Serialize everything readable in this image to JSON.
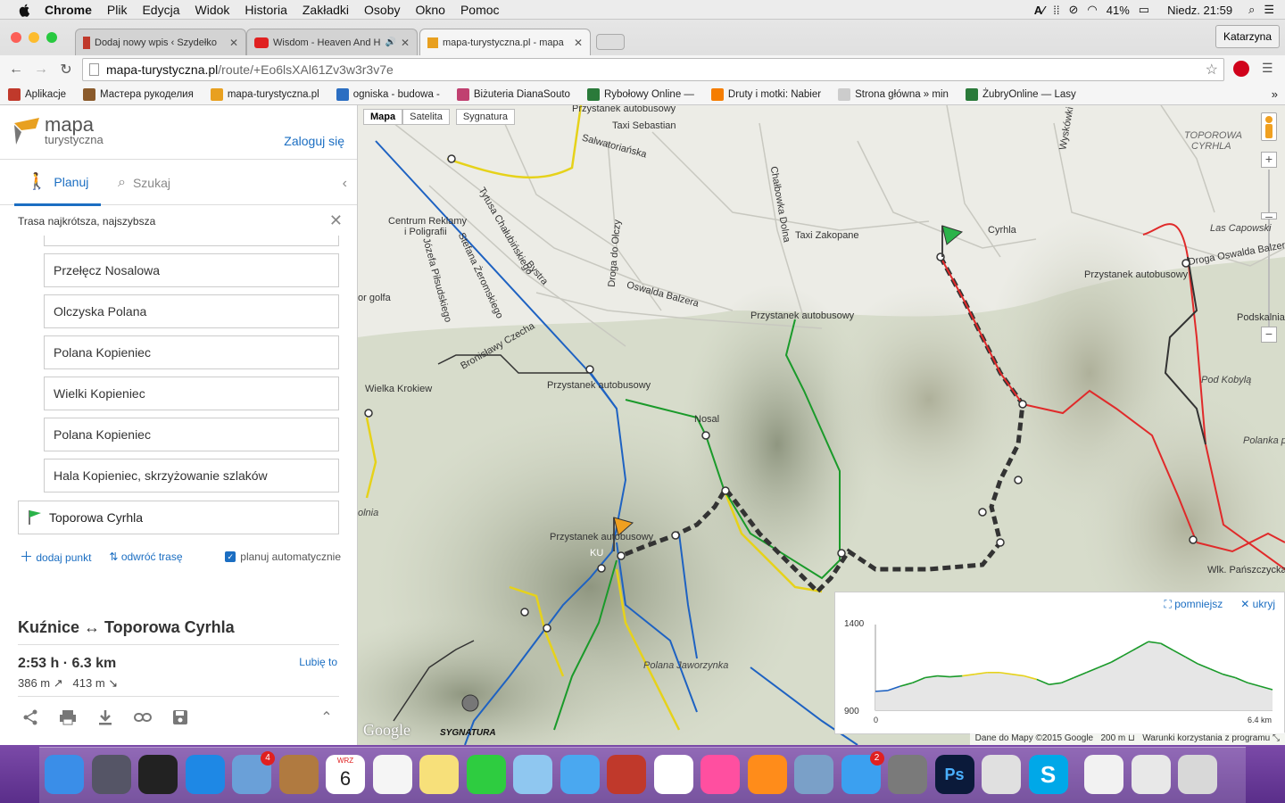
{
  "menubar": {
    "app": "Chrome",
    "items": [
      "Plik",
      "Edycja",
      "Widok",
      "Historia",
      "Zakładki",
      "Osoby",
      "Okno",
      "Pomoc"
    ],
    "battery": "41%",
    "clock": "Niedz. 21:59"
  },
  "browser": {
    "tabs": [
      {
        "title": "Dodaj nowy wpis ‹ Szydełko"
      },
      {
        "title": "Wisdom - Heaven And H"
      },
      {
        "title": "mapa-turystyczna.pl - mapa"
      }
    ],
    "profile": "Katarzyna",
    "url_host": "mapa-turystyczna.pl",
    "url_path": "/route/+Eo6lsXAl61Zv3w3r3v7e",
    "bookmarks": [
      {
        "label": "Aplikacje",
        "icon": "apps-icon",
        "color": "#c0392b"
      },
      {
        "label": "Мастера рукоделия",
        "icon": "bookmark-icon",
        "color": "#8a5a2b"
      },
      {
        "label": "mapa-turystyczna.pl",
        "icon": "mapa-icon",
        "color": "#e8a020"
      },
      {
        "label": "ogniska - budowa -",
        "icon": "b-icon",
        "color": "#2b6ec2"
      },
      {
        "label": "Biżuteria DianaSouto",
        "icon": "bizuteria-icon",
        "color": "#c04070"
      },
      {
        "label": "Rybołowy Online —",
        "icon": "fish-icon",
        "color": "#2a7a3a"
      },
      {
        "label": "Druty i motki: Nabier",
        "icon": "blogger-icon",
        "color": "#f57d00"
      },
      {
        "label": "Strona główna » min",
        "icon": "page-icon",
        "color": "#cccccc"
      },
      {
        "label": "ŻubryOnline — Lasy",
        "icon": "zubr-icon",
        "color": "#2a7a3a"
      }
    ]
  },
  "sidebar": {
    "logo_line1": "mapa",
    "logo_line2": "turystyczna",
    "login": "Zaloguj się",
    "tab_plan": "Planuj",
    "tab_search": "Szukaj",
    "route_type": "Trasa najkrótsza, najszybsza",
    "waypoints": [
      "Przełęcz Nosalowa",
      "Olczyska Polana",
      "Polana Kopieniec",
      "Wielki Kopieniec",
      "Polana Kopieniec",
      "Hala Kopieniec, skrzyżowanie szlaków"
    ],
    "destination": "Toporowa Cyrhla",
    "add_point": "dodaj punkt",
    "reverse": "odwróć trasę",
    "auto_plan": "planuj automatycznie",
    "summary_title": "Kuźnice ↔ Toporowa Cyrhla",
    "time_distance": "2:53 h · 6.3 km",
    "ascent": "386 m",
    "descent": "413 m",
    "like": "Lubię to"
  },
  "map": {
    "type_map": "Mapa",
    "type_satellite": "Satelita",
    "type_sygnatura": "Sygnatura",
    "labels": {
      "przystanek_top": "Przystanek autobusowy",
      "taxi_sebastian": "Taxi Sebastian",
      "salwatorianska": "Salwatoriańska",
      "toporowa_cyrhla": "TOPOROWA",
      "toporowa_cyrhla2": "CYRHLA",
      "centrum_reklamy": "Centrum Reklamy",
      "poligrafii": "i Poligrafii",
      "taxi_zakopane": "Taxi Zakopane",
      "cyrhla": "Cyrhla",
      "las_capowski": "Las Capowski",
      "droga_oswalda": "Droga Oswalda Balzera",
      "przystanek_right": "Przystanek autobusowy",
      "oswalda_balzera": "Oswalda Balzera",
      "przystanek_mid": "Przystanek autobusowy",
      "podkalnia": "Podskalnia Po",
      "or_golfa": "or golfa",
      "bystra": "Bystra",
      "droga_do_olczy": "Droga do Olczy",
      "broniwoja": "Bronisławy Czecha",
      "wielka_krokiew": "Wielka Krokiew",
      "przystanek_left": "Przystanek autobusowy",
      "nosal": "Nosal",
      "pod_kobyla": "Pod Kobylą",
      "polanka_pod": "Polanka pod",
      "olnia": "olnia",
      "przystanek_kuz": "Przystanek autobusowy",
      "kuz": "KU",
      "wlk_panszczycka": "Wlk. Pańszczycka",
      "polana_jaworzynka": "Polana Jaworzynka",
      "chalubinskiego": "Tytusa Chałubińskiego",
      "zeromskiego": "Stefana Żeromskiego",
      "pilsudskiego": "Józefa Piłsudskiego",
      "wyzkowki": "Wyskówki",
      "chalupa": "Chałbowka Dolna",
      "sygnatura_logo": "SYGNATURA",
      "google_logo": "Google"
    },
    "elevation": {
      "shrink": "pomniejsz",
      "hide": "ukryj",
      "max_label": "1400",
      "min_label": "900",
      "x_start": "0",
      "x_end": "6.4 km"
    },
    "footer_data": "Dane do Mapy ©2015 Google",
    "footer_scale": "200 m",
    "footer_terms": "Warunki korzystania z programu"
  },
  "chart_data": {
    "type": "area",
    "title": "",
    "xlabel": "",
    "ylabel": "",
    "xlim": [
      0,
      6.4
    ],
    "ylim": [
      900,
      1400
    ],
    "x": [
      0.0,
      0.2,
      0.4,
      0.6,
      0.8,
      1.0,
      1.2,
      1.4,
      1.6,
      1.8,
      2.0,
      2.2,
      2.4,
      2.6,
      2.8,
      3.0,
      3.2,
      3.4,
      3.6,
      3.8,
      4.0,
      4.2,
      4.4,
      4.6,
      4.8,
      5.0,
      5.2,
      5.4,
      5.6,
      5.8,
      6.0,
      6.2,
      6.4
    ],
    "series": [
      {
        "values": [
          1010,
          1015,
          1040,
          1060,
          1090,
          1100,
          1095,
          1100,
          1110,
          1120,
          1120,
          1110,
          1100,
          1080,
          1050,
          1060,
          1090,
          1120,
          1150,
          1180,
          1220,
          1260,
          1300,
          1290,
          1250,
          1210,
          1170,
          1140,
          1110,
          1090,
          1060,
          1040,
          1020
        ]
      }
    ]
  },
  "dock": {
    "apps": [
      {
        "name": "finder-icon",
        "color": "#3a8ee8"
      },
      {
        "name": "launchpad-icon",
        "color": "#555566"
      },
      {
        "name": "mission-control-icon",
        "color": "#222222"
      },
      {
        "name": "safari-icon",
        "color": "#1e88e5"
      },
      {
        "name": "mail-icon",
        "color": "#6aa0d8",
        "badge": "4"
      },
      {
        "name": "contacts-icon",
        "color": "#b07a40"
      },
      {
        "name": "calendar-icon",
        "color": "#ffffff",
        "text": "6",
        "sub": "WRZ"
      },
      {
        "name": "reminders-icon",
        "color": "#f5f5f5"
      },
      {
        "name": "notes-icon",
        "color": "#f7e07a"
      },
      {
        "name": "facetime-icon",
        "color": "#2ecc40"
      },
      {
        "name": "maps-icon",
        "color": "#8fc7f0"
      },
      {
        "name": "messages-icon",
        "color": "#4aa8f0"
      },
      {
        "name": "photobooth-icon",
        "color": "#c0392b"
      },
      {
        "name": "photos-icon",
        "color": "#ffffff"
      },
      {
        "name": "itunes-icon",
        "color": "#ff4fa0"
      },
      {
        "name": "ibooks-icon",
        "color": "#ff8c1a"
      },
      {
        "name": "preview-icon",
        "color": "#7aa0c8"
      },
      {
        "name": "appstore-icon",
        "color": "#3ba0f0",
        "badge": "2"
      },
      {
        "name": "system-prefs-icon",
        "color": "#7a7a7a"
      },
      {
        "name": "photoshop-icon",
        "color": "#0b1a3a",
        "text": "Ps"
      },
      {
        "name": "chrome-icon",
        "color": "#e0e0e0"
      },
      {
        "name": "skype-icon",
        "color": "#00a8e8",
        "text": "S"
      },
      {
        "name": "document-icon",
        "color": "#f2f2f2"
      },
      {
        "name": "downloads-icon",
        "color": "#e8e8e8"
      },
      {
        "name": "trash-icon",
        "color": "#d8d8d8"
      }
    ]
  }
}
